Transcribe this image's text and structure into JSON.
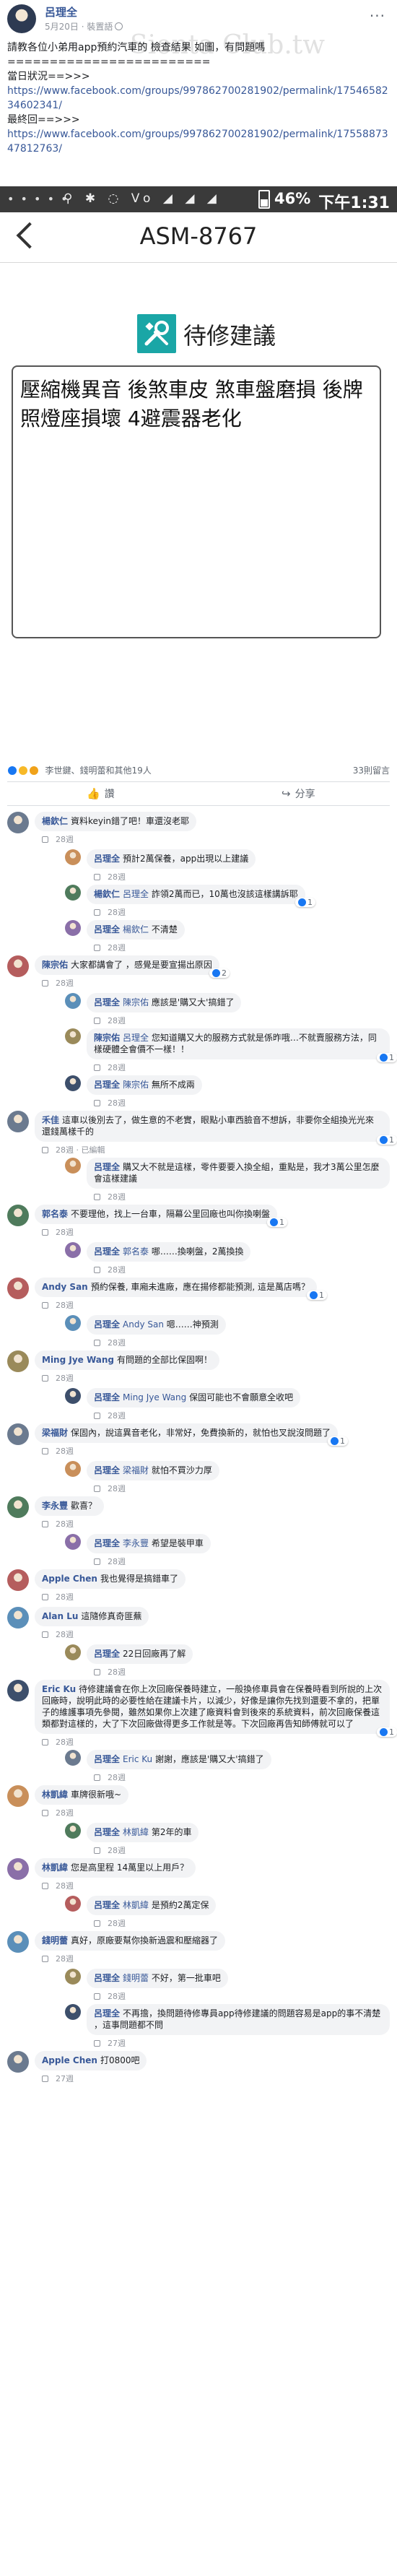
{
  "post": {
    "author": "呂理全",
    "meta": "5月20日 · 裝置語",
    "watermark": "Sienta Club.tw",
    "more_label": "···",
    "body_line1": "請教各位小弟用app預約汽車的 檢查結果 如圖，有問題嗎",
    "divider": "========================",
    "section1_label": "當日狀況==>>>",
    "link1": "https://www.facebook.com/groups/997862700281902/permalink/1754658234602341/",
    "section2_label": "最終回==>>>",
    "link2": "https://www.facebook.com/groups/997862700281902/permalink/1755887347812763/"
  },
  "screenshot": {
    "status_left": "• • • • •",
    "status_icons": "⚲ ✱ ◌ Vo ◢ ◢ ◢",
    "battery_pct": "46%",
    "time": "下午1:31",
    "page_title": "ASM-8767",
    "section_title": "待修建議",
    "note": "壓縮機異音 後煞車皮 煞車盤磨損 後牌照燈座損壞 4避震器老化"
  },
  "reactions": {
    "names": "李世鍵、錢明蕾和其他19人",
    "comment_count": "33則留言"
  },
  "actions": {
    "like": "讚",
    "share": "分享"
  },
  "comments": [
    {
      "name": "楊欽仁",
      "text": "資料keyin錯了吧！車還沒老耶",
      "meta": "28週",
      "react": ""
    },
    {
      "name": "呂理全",
      "text": "預計2萬保養，app出現以上建議",
      "meta": "28週",
      "react": ""
    },
    {
      "name": "楊欽仁",
      "tag": "呂理全",
      "text": "詐領2萬而已，10萬也沒該這樣講訴耶",
      "meta": "28週",
      "react": "1"
    },
    {
      "name": "呂理全",
      "tag": "楊欽仁",
      "text": "不清楚 ",
      "meta": "28週",
      "react": ""
    },
    {
      "name": "陳宗佑",
      "text": "大家都講會了 ，感覺是要宣揚出原因",
      "meta": "28週",
      "react": "2"
    },
    {
      "name": "呂理全",
      "tag": "陳宗佑",
      "text": "應該是'購又大'搞錯了",
      "meta": "28週",
      "react": ""
    },
    {
      "name": "陳宗佑",
      "tag": "呂理全",
      "text": "您知道購又大的服務方式就是係昨哦…不就賣服務方法，同樣硬體全會價不一樣！！",
      "meta": "28週",
      "react": "1"
    },
    {
      "name": "呂理全",
      "tag": "陳宗佑",
      "text": "無所不成兩",
      "meta": "28週",
      "react": ""
    },
    {
      "name": "禾佳",
      "text": "這車以後別去了，做生意的不老實，眼點小車西臉音不想訴，非要你全組換光光來還錢萬樣千的",
      "meta": "28週 · 已編輯",
      "react": "1"
    },
    {
      "name": "呂理全",
      "text": "購又大不就是這樣，零件要要入換全組，重點是，我才3萬公里怎麼會這樣建議",
      "meta": "28週",
      "react": ""
    },
    {
      "name": "郭名泰",
      "text": "不要理他，找上一台車，隔幕公里回廠也叫你換喇盤",
      "meta": "28週",
      "react": "1"
    },
    {
      "name": "呂理全",
      "tag": "郭名泰",
      "text": "哪……換喇盤，2萬換換",
      "meta": "28週",
      "react": ""
    },
    {
      "name": "Andy San",
      "text": "預約保養, 車廂未進廠，應在揚修都能預測, 這是萬店嗎？",
      "meta": "28週",
      "react": "1"
    },
    {
      "name": "呂理全",
      "tag": "Andy San",
      "text": "嗯……神預測",
      "meta": "28週",
      "react": ""
    },
    {
      "name": "Ming Jye Wang",
      "text": "有問題的全部比保固啊！",
      "meta": "28週",
      "react": ""
    },
    {
      "name": "呂理全",
      "tag": "Ming Jye Wang",
      "text": "保固可能也不會願意全收吧",
      "meta": "28週",
      "react": ""
    },
    {
      "name": "梁福財",
      "text": "保固內，說這異音老化，非常好，免費換新的，就怕也叉說沒問題了",
      "meta": "28週",
      "react": "1"
    },
    {
      "name": "呂理全",
      "tag": "梁福財",
      "text": "就怕不買沙力厚",
      "meta": "28週",
      "react": ""
    },
    {
      "name": "李永豐",
      "text": "歡喜？",
      "meta": "28週",
      "react": ""
    },
    {
      "name": "呂理全",
      "tag": "李永豐",
      "text": "希望是裝甲車",
      "meta": "28週",
      "react": ""
    },
    {
      "name": "Apple Chen",
      "text": "我也覺得是搞錯車了",
      "meta": "28週",
      "react": ""
    },
    {
      "name": "Alan Lu",
      "text": "這隨修真奇匪蕪",
      "meta": "28週",
      "react": ""
    },
    {
      "name": "呂理全",
      "text": "22日回廠再了解",
      "meta": "28週",
      "react": ""
    },
    {
      "name": "Eric Ku",
      "text": "待修建議會在你上次回廠保養時建立，一般換修車員會在保養時看到所說的上次回廠時，說明此時的必要性給在建議卡片，以減少，好像是讓你先找到還要不拿的，把單子的維護事項先參閱，雖然如果你上次建了廠資料會到後來的系統資料，前次回廠保養這類都對這樣的，大了下次回廠做得更多工作就是等。下次回廠再告知師傅就可以了",
      "meta": "28週",
      "react": "1"
    },
    {
      "name": "呂理全",
      "tag": "Eric Ku",
      "text": "謝謝，應該是'購又大'搞錯了",
      "meta": "28週",
      "react": ""
    },
    {
      "name": "林凱緯",
      "text": "車牌很新哦~",
      "meta": "28週",
      "react": ""
    },
    {
      "name": "呂理全",
      "tag": "林凱緯",
      "text": "第2年的車",
      "meta": "28週",
      "react": ""
    },
    {
      "name": "林凱緯",
      "text": "您是高里程 14萬里以上用戶？",
      "meta": "28週",
      "react": ""
    },
    {
      "name": "呂理全",
      "tag": "林凱緯",
      "text": "是預約2萬定保",
      "meta": "28週",
      "react": ""
    },
    {
      "name": "錢明蕾",
      "text": "真好，原廠要幫你換新過震和壓縮器了",
      "meta": "28週",
      "react": ""
    },
    {
      "name": "呂理全",
      "tag": "錢明蕾",
      "text": "不好，第一批車吧",
      "meta": "28週",
      "react": ""
    },
    {
      "name": "呂理全",
      "text": "不再擔，換問題待修專員app待修建議的問題容易是app的事不清楚 ，這事問題都不問",
      "meta": "27週",
      "react": ""
    },
    {
      "name": "Apple Chen",
      "text": "打0800吧",
      "meta": "27週",
      "react": ""
    }
  ],
  "colors": {
    "link": "#385898",
    "meta": "#90949c",
    "bubble": "#f2f3f5",
    "statusbar": "#3a3a3a",
    "teal": "#1aa6a6"
  }
}
